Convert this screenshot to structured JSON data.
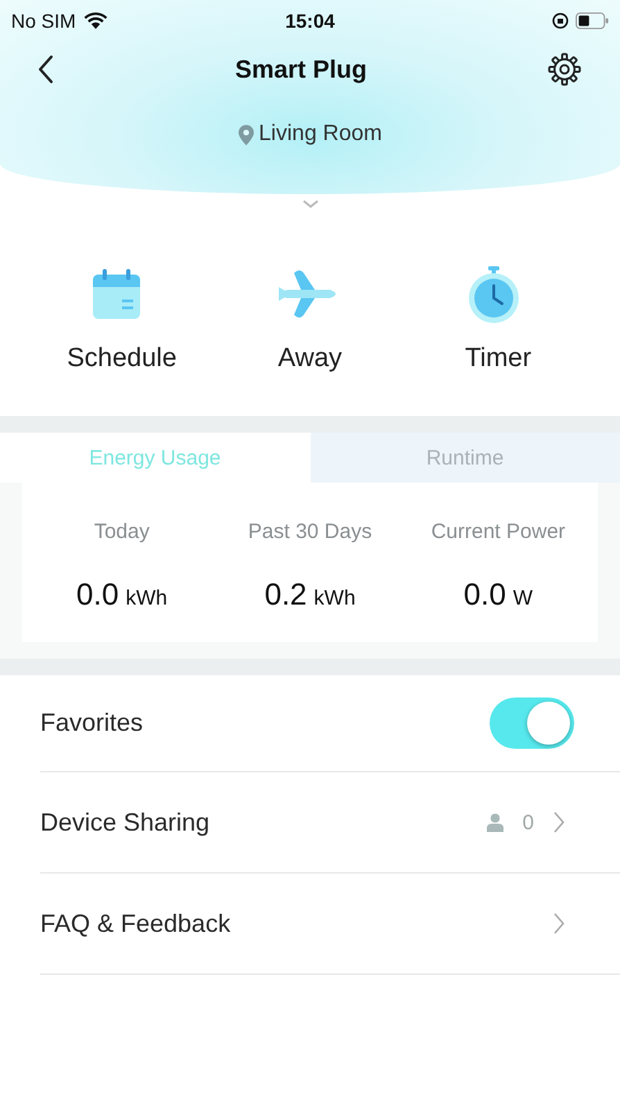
{
  "status_bar": {
    "carrier": "No SIM",
    "time": "15:04"
  },
  "header": {
    "title": "Smart Plug",
    "location": "Living Room"
  },
  "modes": [
    {
      "kind": "schedule",
      "label": "Schedule"
    },
    {
      "kind": "away",
      "label": "Away"
    },
    {
      "kind": "timer",
      "label": "Timer"
    }
  ],
  "tabs": [
    {
      "label": "Energy Usage",
      "selected": true
    },
    {
      "label": "Runtime",
      "selected": false
    }
  ],
  "stats": [
    {
      "label": "Today",
      "value": "0.0",
      "unit": "kWh"
    },
    {
      "label": "Past 30 Days",
      "value": "0.2",
      "unit": "kWh"
    },
    {
      "label": "Current Power",
      "value": "0.0",
      "unit": "W"
    }
  ],
  "settings": [
    {
      "kind": "toggle",
      "label": "Favorites",
      "on": true
    },
    {
      "kind": "sharing",
      "label": "Device Sharing",
      "count": "0"
    },
    {
      "kind": "link",
      "label": "FAQ & Feedback"
    }
  ]
}
